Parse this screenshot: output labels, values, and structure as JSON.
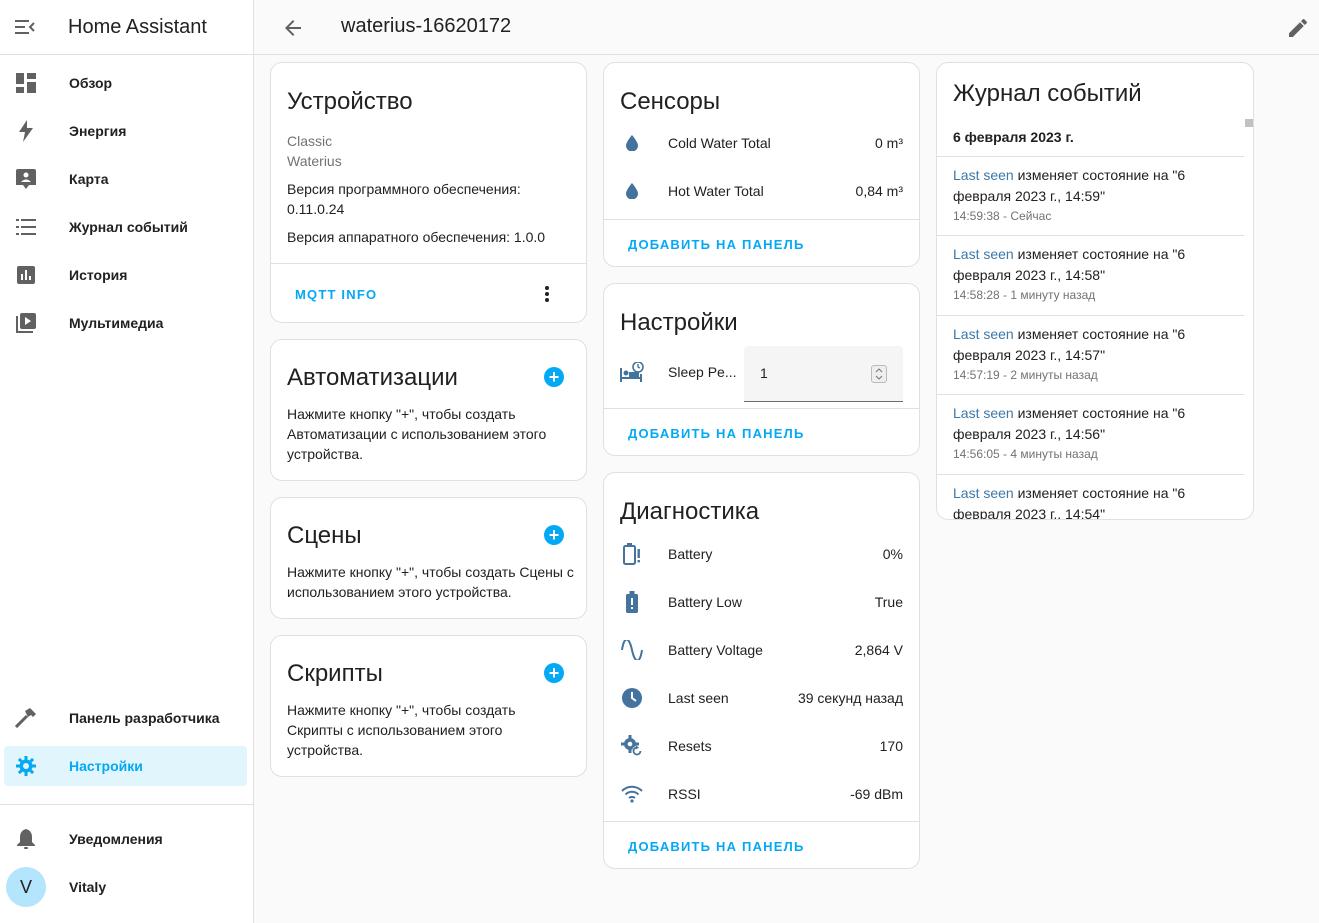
{
  "app": {
    "title": "Home Assistant"
  },
  "sidebar": {
    "items": [
      {
        "label": "Обзор",
        "icon": "dashboard-icon"
      },
      {
        "label": "Энергия",
        "icon": "lightning-icon"
      },
      {
        "label": "Карта",
        "icon": "map-account-icon"
      },
      {
        "label": "Журнал событий",
        "icon": "list-icon"
      },
      {
        "label": "История",
        "icon": "chart-box-icon"
      },
      {
        "label": "Мультимедиа",
        "icon": "play-box-icon"
      }
    ],
    "developer": {
      "label": "Панель разработчика",
      "icon": "hammer-icon"
    },
    "settings": {
      "label": "Настройки",
      "icon": "gear-icon"
    },
    "notifications": {
      "label": "Уведомления",
      "icon": "bell-icon"
    },
    "user": {
      "label": "Vitaly",
      "initial": "V"
    }
  },
  "topbar": {
    "title": "waterius-16620172"
  },
  "device": {
    "title": "Устройство",
    "model": "Classic",
    "manufacturer": "Waterius",
    "sw_label": "Версия программного обеспечения:",
    "sw_version": "0.11.0.24",
    "hw_text": "Версия аппаратного обеспечения: 1.0.0",
    "mqtt_button": "MQTT INFO"
  },
  "automations": {
    "title": "Автоматизации",
    "text": "Нажмите кнопку \"+\", чтобы создать Автоматизации с использованием этого устройства."
  },
  "scenes": {
    "title": "Сцены",
    "text": "Нажмите кнопку \"+\", чтобы создать Сцены с использованием этого устройства."
  },
  "scripts": {
    "title": "Скрипты",
    "text": "Нажмите кнопку \"+\", чтобы создать Скрипты с использованием этого устройства."
  },
  "sensors": {
    "title": "Сенсоры",
    "rows": [
      {
        "name": "Cold Water Total",
        "value": "0 m³",
        "icon": "water-drop-icon"
      },
      {
        "name": "Hot Water Total",
        "value": "0,84 m³",
        "icon": "water-drop-icon"
      }
    ],
    "add_button": "ДОБАВИТЬ НА ПАНЕЛЬ"
  },
  "settings_card": {
    "title": "Настройки",
    "row_name": "Sleep Pe...",
    "row_value": "1",
    "add_button": "ДОБАВИТЬ НА ПАНЕЛЬ"
  },
  "diagnostics": {
    "title": "Диагностика",
    "rows": [
      {
        "name": "Battery",
        "value": "0%",
        "icon": "battery-alert-icon"
      },
      {
        "name": "Battery Low",
        "value": "True",
        "icon": "battery-alert-filled-icon"
      },
      {
        "name": "Battery Voltage",
        "value": "2,864 V",
        "icon": "sine-wave-icon"
      },
      {
        "name": "Last seen",
        "value": "39 секунд назад",
        "icon": "clock-icon"
      },
      {
        "name": "Resets",
        "value": "170",
        "icon": "cog-refresh-icon"
      },
      {
        "name": "RSSI",
        "value": "-69 dBm",
        "icon": "wifi-icon"
      }
    ],
    "add_button": "ДОБАВИТЬ НА ПАНЕЛЬ"
  },
  "logbook": {
    "title": "Журнал событий",
    "date": "6 февраля 2023 г.",
    "entries": [
      {
        "entity": "Last seen",
        "text": " изменяет состояние на \"6 февраля 2023 г., 14:59\"",
        "time": "14:59:38 - Сейчас"
      },
      {
        "entity": "Last seen",
        "text": " изменяет состояние на \"6 февраля 2023 г., 14:58\"",
        "time": "14:58:28 - 1 минуту назад"
      },
      {
        "entity": "Last seen",
        "text": " изменяет состояние на \"6 февраля 2023 г., 14:57\"",
        "time": "14:57:19 - 2 минуты назад"
      },
      {
        "entity": "Last seen",
        "text": " изменяет состояние на \"6 февраля 2023 г., 14:56\"",
        "time": "14:56:05 - 4 минуты назад"
      },
      {
        "entity": "Last seen",
        "text": " изменяет состояние на \"6 февраля 2023 г., 14:54\"",
        "time": ""
      }
    ]
  },
  "colors": {
    "accent": "#03a9f4",
    "icon": "#44739e",
    "entity_link": "#3c78a8"
  }
}
